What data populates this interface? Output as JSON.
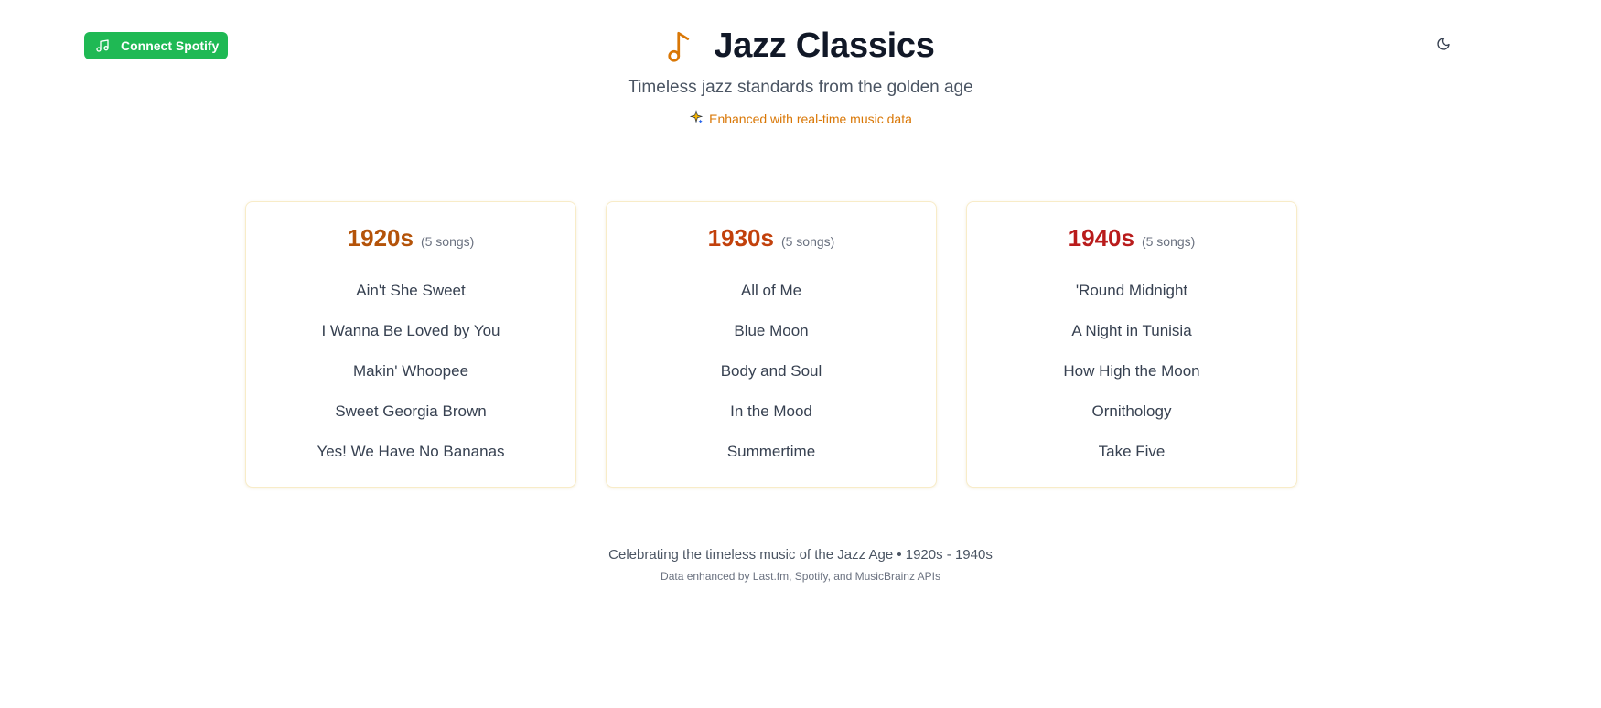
{
  "header": {
    "spotify_button_label": "Connect Spotify",
    "title": "Jazz Classics",
    "subtitle": "Timeless jazz standards from the golden age",
    "enhanced_note": "Enhanced with real-time music data",
    "icons": {
      "spotify": "music-note-icon",
      "title": "music-note-icon",
      "enhanced": "sparkle-icon",
      "theme": "moon-icon"
    }
  },
  "colors": {
    "spotify_green": "#1fb954",
    "accent_amber": "#d97706",
    "decade_1920s": "#b45309",
    "decade_1930s": "#c2410c",
    "decade_1940s": "#b91c1c"
  },
  "decades": [
    {
      "label": "1920s",
      "count": "(5 songs)",
      "songs": [
        "Ain't She Sweet",
        "I Wanna Be Loved by You",
        "Makin' Whoopee",
        "Sweet Georgia Brown",
        "Yes! We Have No Bananas"
      ]
    },
    {
      "label": "1930s",
      "count": "(5 songs)",
      "songs": [
        "All of Me",
        "Blue Moon",
        "Body and Soul",
        "In the Mood",
        "Summertime"
      ]
    },
    {
      "label": "1940s",
      "count": "(5 songs)",
      "songs": [
        "'Round Midnight",
        "A Night in Tunisia",
        "How High the Moon",
        "Ornithology",
        "Take Five"
      ]
    }
  ],
  "footer": {
    "main": "Celebrating the timeless music of the Jazz Age • 1920s - 1940s",
    "sub": "Data enhanced by Last.fm, Spotify, and MusicBrainz APIs"
  }
}
